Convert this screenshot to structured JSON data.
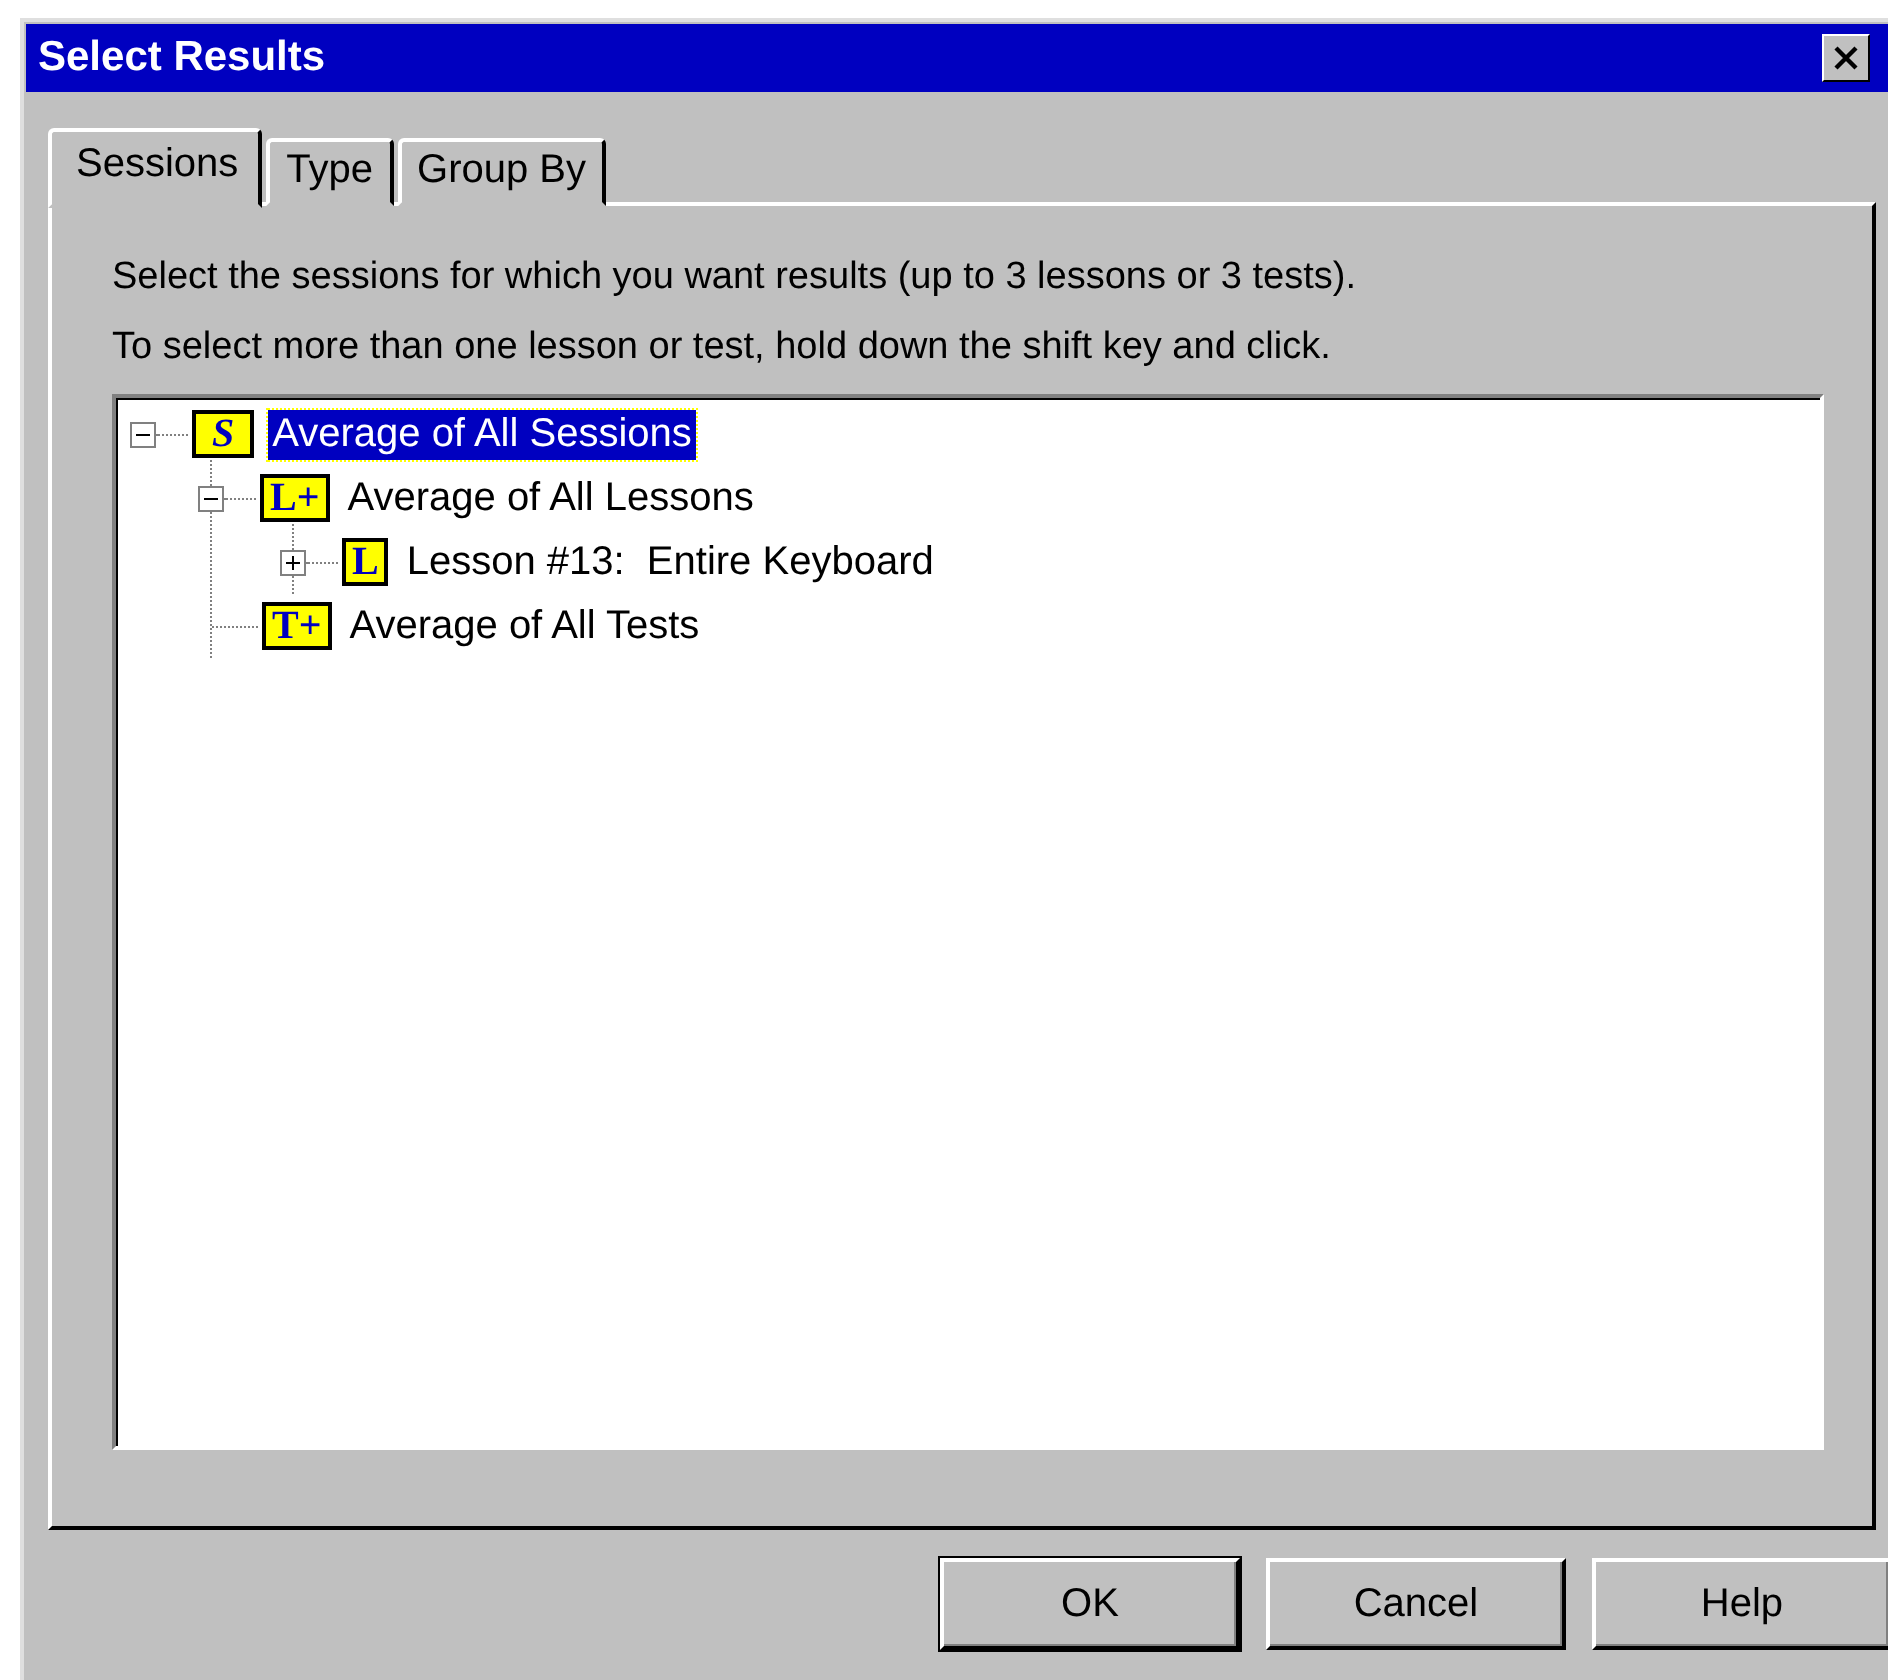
{
  "window": {
    "title": "Select Results"
  },
  "tabs": [
    {
      "label": "Sessions",
      "selected": true
    },
    {
      "label": "Type",
      "selected": false
    },
    {
      "label": "Group By",
      "selected": false
    }
  ],
  "instructions": [
    "Select the sessions for which you want results (up to 3 lessons or 3 tests).",
    "To select more than one lesson or test, hold down the shift key and click."
  ],
  "tree": [
    {
      "kind": "branch",
      "expanded": true,
      "badge": "S",
      "badge_italic": true,
      "label": "Average of All Sessions",
      "selected": true,
      "children": [
        {
          "kind": "branch",
          "expanded": true,
          "badge": "L+",
          "badge_italic": false,
          "label": "Average of All Lessons",
          "selected": false,
          "children": [
            {
              "kind": "branch",
              "expanded": false,
              "badge": "L",
              "badge_italic": false,
              "label": "Lesson #13:  Entire Keyboard",
              "selected": false
            }
          ]
        },
        {
          "kind": "leaf",
          "badge": "T+",
          "badge_italic": false,
          "label": "Average of All Tests",
          "selected": false
        }
      ]
    }
  ],
  "buttons": [
    {
      "label": "OK",
      "default": true
    },
    {
      "label": "Cancel",
      "default": false
    },
    {
      "label": "Help",
      "default": false
    }
  ]
}
